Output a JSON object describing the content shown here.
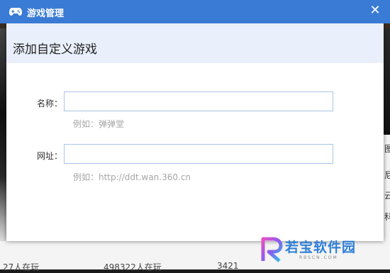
{
  "window": {
    "title": "游戏管理",
    "close_glyph": "✕"
  },
  "dialog": {
    "heading": "添加自定义游戏",
    "name_field": {
      "label": "名称：",
      "value": "",
      "hint": "例如：弹弹堂"
    },
    "url_field": {
      "label": "网址：",
      "value": "",
      "hint": "例如：http://ddt.wan.360.cn"
    }
  },
  "background": {
    "right_fragments": [
      "图",
      "尼",
      "云",
      "科"
    ],
    "bottom_texts": [
      "27人在玩",
      "498322人在玩",
      "3421"
    ]
  },
  "watermark": {
    "text": "若宝软件园",
    "sub": "RBSCN.COM"
  },
  "colors": {
    "titlebar": "#3a7bd5",
    "header_band": "#eaf0fb",
    "input_border": "#a9c5e6",
    "hint": "#a6a6a6"
  },
  "icons": {
    "window_icon": "gamepad-icon",
    "close": "close-icon",
    "watermark_logo": "r-logo-icon"
  }
}
